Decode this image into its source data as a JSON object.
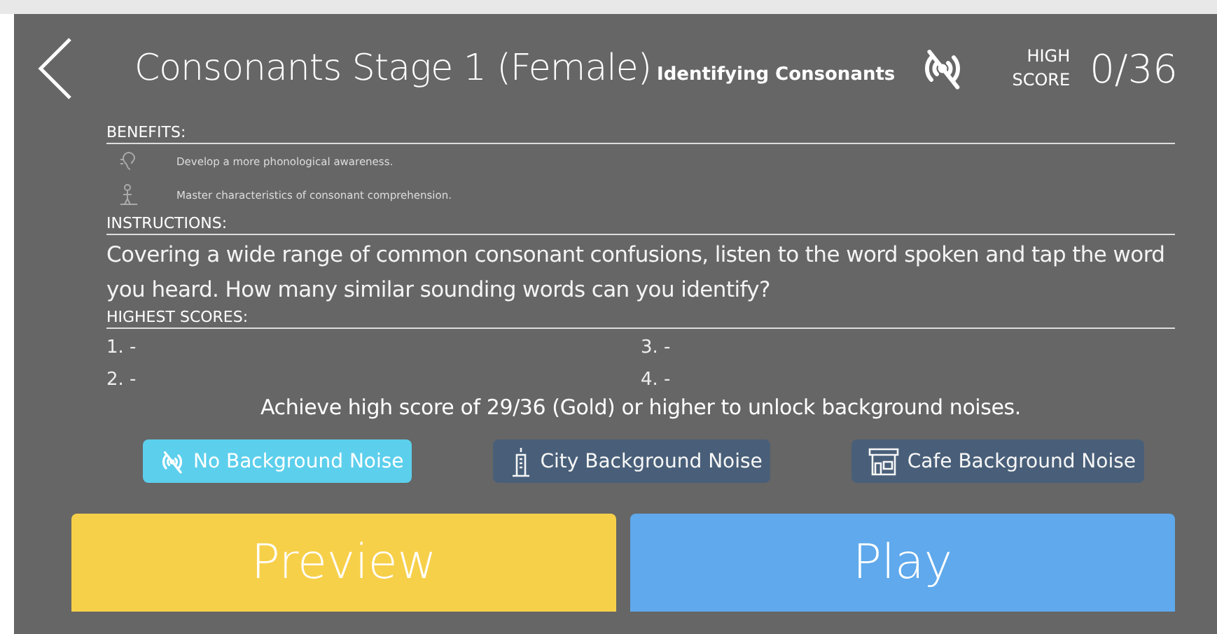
{
  "header": {
    "title": "Consonants Stage 1 (Female)",
    "subtitle": "Identifying Consonants",
    "high_score_label": [
      "HIGH",
      "SCORE"
    ],
    "high_score": "0/36"
  },
  "benefits": {
    "heading": "BENEFITS:",
    "items": [
      {
        "kind": "ear",
        "text": "Develop a more phonological awareness."
      },
      {
        "kind": "person",
        "text": "Master characteristics of consonant comprehension."
      }
    ]
  },
  "instructions": {
    "heading": "INSTRUCTIONS:",
    "text": "Covering a wide range of common consonant confusions, listen to the word spoken and tap the word you heard. How many similar sounding words can you identify?"
  },
  "highest_scores": {
    "heading": "HIGHEST SCORES:",
    "entries": [
      "1. -",
      "3. -",
      "2. -",
      "4. -"
    ]
  },
  "unlock_note": "Achieve high score of 29/36 (Gold) or higher to unlock background noises.",
  "noise_options": [
    {
      "kind": "none",
      "label": "No Background Noise",
      "selected": true
    },
    {
      "kind": "city",
      "label": "City  Background Noise",
      "selected": false
    },
    {
      "kind": "cafe",
      "label": "Cafe Background Noise",
      "selected": false
    }
  ],
  "actions": [
    {
      "kind": "preview",
      "label": "Preview"
    },
    {
      "kind": "play",
      "label": "Play"
    }
  ]
}
